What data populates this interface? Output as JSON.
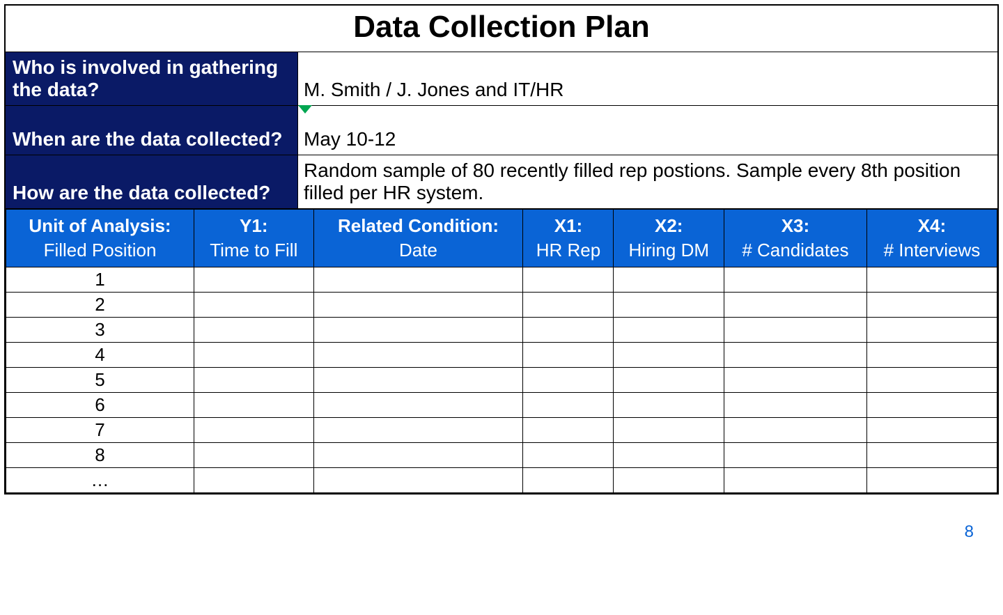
{
  "title": "Data Collection Plan",
  "meta": {
    "who_label": "Who is involved in gathering the data?",
    "who_value": "M. Smith / J. Jones and IT/HR",
    "when_label": "When are the data collected?",
    "when_value": "May 10-12",
    "how_label": "How are the data collected?",
    "how_value": "Random sample of 80 recently filled rep postions. Sample every 8th position filled per HR system."
  },
  "headers": {
    "c0": {
      "top": "Unit of Analysis:",
      "bot": "Filled Position"
    },
    "c1": {
      "top": "Y1:",
      "bot": "Time to Fill"
    },
    "c2": {
      "top": "Related Condition:",
      "bot": "Date"
    },
    "c3": {
      "top": "X1:",
      "bot": "HR Rep"
    },
    "c4": {
      "top": "X2:",
      "bot": "Hiring DM"
    },
    "c5": {
      "top": "X3:",
      "bot": "# Candidates"
    },
    "c6": {
      "top": "X4:",
      "bot": "# Interviews"
    }
  },
  "rows": [
    "1",
    "2",
    "3",
    "4",
    "5",
    "6",
    "7",
    "8",
    "…"
  ],
  "page_number": "8"
}
